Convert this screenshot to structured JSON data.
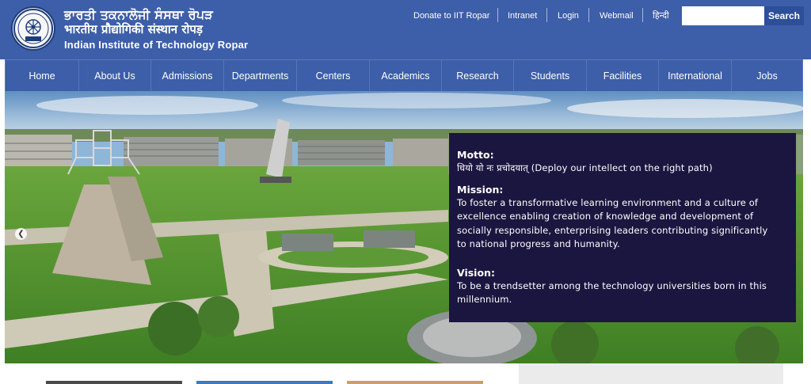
{
  "header": {
    "name_punjabi": "ਭਾਰਤੀ ਤਕਨਾਲੋਜੀ ਸੰਸਥਾ ਰੋਪੜ",
    "name_hindi": "भारतीय प्रौद्योगिकी संस्थान रोपड़",
    "name_english": "Indian Institute of Technology Ropar",
    "top_links": [
      "Donate to IIT Ropar",
      "Intranet",
      "Login",
      "Webmail",
      "हिन्दी"
    ],
    "search_placeholder": "",
    "search_button": "Search"
  },
  "nav": {
    "items": [
      "Home",
      "About Us",
      "Admissions",
      "Departments",
      "Centers",
      "Academics",
      "Research",
      "Students",
      "Facilities",
      "International",
      "Jobs"
    ]
  },
  "banner": {
    "prev_icon": "chevron-left-icon",
    "next_icon": "chevron-right-icon",
    "prev_glyph": "❮",
    "next_glyph": "❯",
    "motto_heading": "Motto:",
    "motto_text": "धियो यो नः प्रचोदयात्  (Deploy our intellect on the right path)",
    "mission_heading": "Mission:",
    "mission_lines": [
      "To foster a transformative learning environment and a culture of",
      "excellence enabling creation of knowledge and development of",
      "socially responsible, enterprising leaders contributing significantly",
      "to national progress and humanity."
    ],
    "vision_heading": "Vision:",
    "vision_lines": [
      "To be a trendsetter among the technology universities born in this",
      "millennium."
    ]
  },
  "colors": {
    "header_bg": "#3d5ea8",
    "search_button_bg": "#2d4f9a",
    "info_box_bg": "#1b1640"
  }
}
